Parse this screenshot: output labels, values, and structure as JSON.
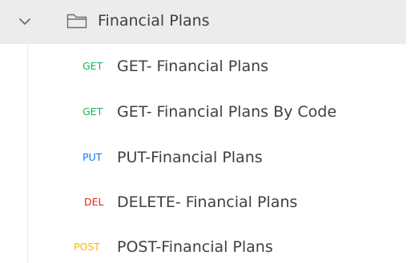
{
  "folder": {
    "name": "Financial Plans",
    "expanded_icon": "chevron-down-icon",
    "icon": "folder-icon"
  },
  "requests": [
    {
      "method": "GET",
      "method_color": "#0cbb52",
      "name": "GET- Financial Plans"
    },
    {
      "method": "GET",
      "method_color": "#0cbb52",
      "name": "GET- Financial Plans By Code"
    },
    {
      "method": "PUT",
      "method_color": "#097bed",
      "name": "PUT-Financial Plans"
    },
    {
      "method": "DEL",
      "method_color": "#eb2013",
      "name": "DELETE- Financial Plans"
    },
    {
      "method": "POST",
      "method_color": "#ffb400",
      "name": "POST-Financial Plans"
    }
  ],
  "colors": {
    "folder_row_background": "#ececec",
    "text": "#3f3f3f",
    "icon": "#6b6b6b"
  }
}
